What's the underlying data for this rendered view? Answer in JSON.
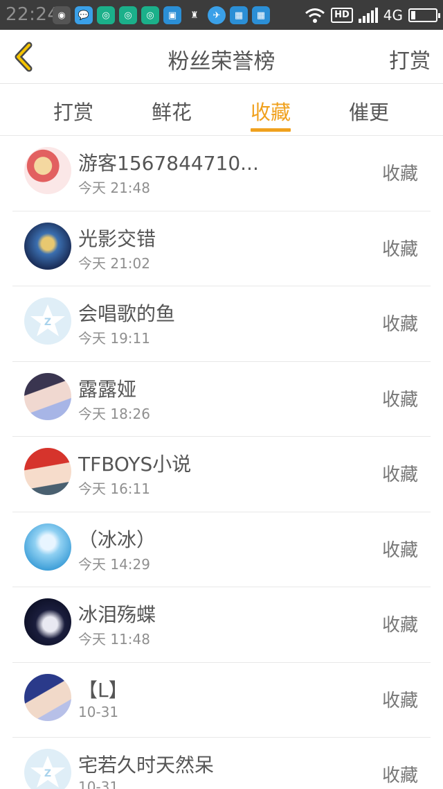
{
  "status_bar": {
    "time": "22:24",
    "network": "4G",
    "hd_label": "HD"
  },
  "header": {
    "title": "粉丝荣誉榜",
    "right_action": "打赏"
  },
  "tabs": [
    {
      "label": "打赏",
      "active": false
    },
    {
      "label": "鲜花",
      "active": false
    },
    {
      "label": "收藏",
      "active": true
    },
    {
      "label": "催更",
      "active": false
    }
  ],
  "accent_color": "#f0a11e",
  "list": [
    {
      "name": "游客1567844710...",
      "time": "今天 21:48",
      "action": "收藏"
    },
    {
      "name": "光影交错",
      "time": "今天 21:02",
      "action": "收藏"
    },
    {
      "name": "会唱歌的鱼",
      "time": "今天 19:11",
      "action": "收藏"
    },
    {
      "name": "露露娅",
      "time": "今天 18:26",
      "action": "收藏"
    },
    {
      "name": "TFBOYS小说",
      "time": "今天 16:11",
      "action": "收藏"
    },
    {
      "name": "（冰冰）",
      "time": "今天 14:29",
      "action": "收藏"
    },
    {
      "name": "冰泪殇蝶",
      "time": "今天 11:48",
      "action": "收藏"
    },
    {
      "name": "【L】",
      "time": "10-31",
      "action": "收藏"
    },
    {
      "name": "宅若久时天然呆",
      "time": "10-31",
      "action": "收藏"
    }
  ]
}
